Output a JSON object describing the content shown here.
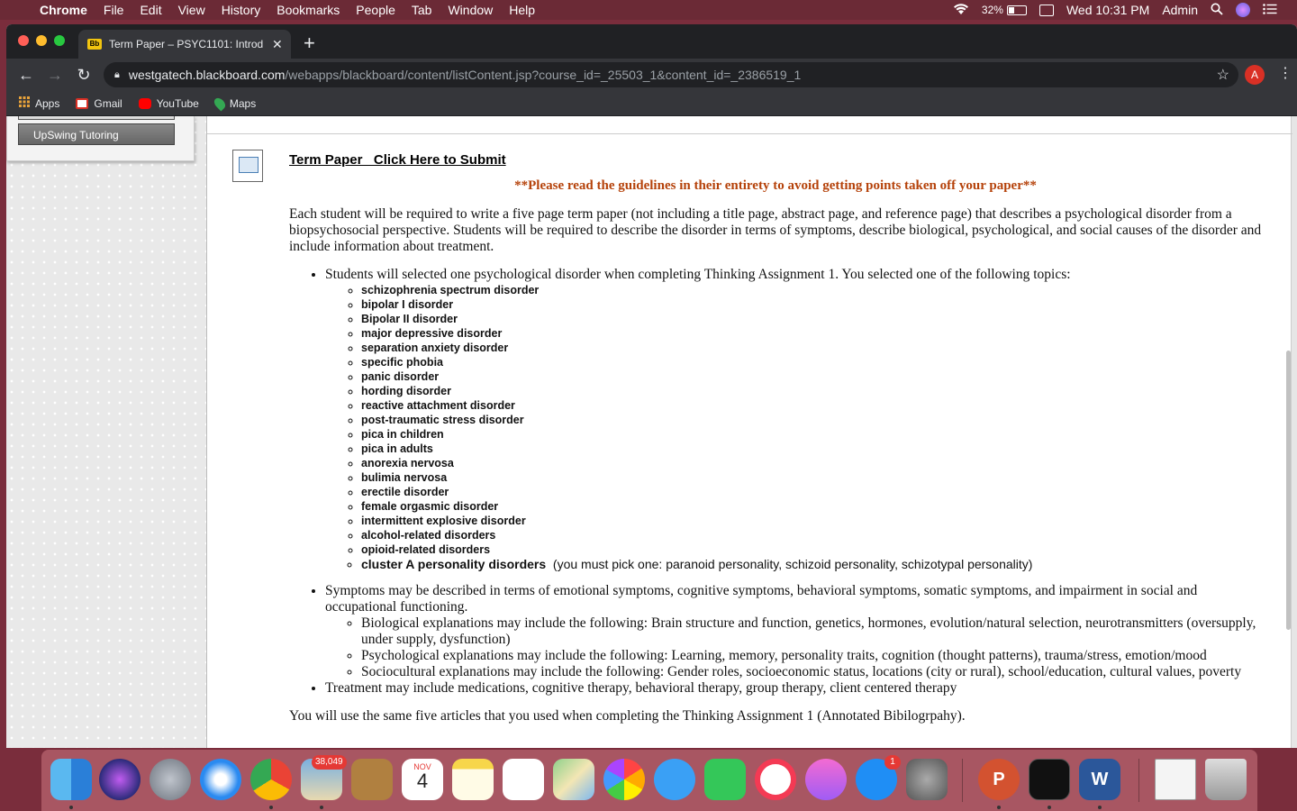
{
  "menubar": {
    "app": "Chrome",
    "items": [
      "File",
      "Edit",
      "View",
      "History",
      "Bookmarks",
      "People",
      "Tab",
      "Window",
      "Help"
    ],
    "battery": "32%",
    "clock": "Wed 10:31 PM",
    "user": "Admin"
  },
  "tab": {
    "favicon": "Bb",
    "title": "Term Paper – PSYC1101: Introd"
  },
  "address": {
    "host": "westgatech.blackboard.com",
    "path": "/webapps/blackboard/content/listContent.jsp?course_id=_25503_1&content_id=_2386519_1"
  },
  "profile_initial": "A",
  "bookmarks": [
    "Apps",
    "Gmail",
    "YouTube",
    "Maps"
  ],
  "sidebar": {
    "button": "UpSwing Tutoring"
  },
  "content": {
    "title": "Term Paper _Click Here to Submit",
    "warning": "**Please read the guidelines in their entirety to avoid getting points taken off your paper**",
    "intro": "Each student will be required to write a five page term paper (not including a title page, abstract page, and reference page) that describes a psychological disorder from a biopsychosocial perspective. Students will be required to describe the disorder in terms of symptoms, describe biological, psychological, and social causes of the disorder and include information about treatment.",
    "bullet1": "Students will selected one psychological disorder when completing Thinking Assignment 1.  You selected one of the following topics:",
    "topics": [
      "schizophrenia spectrum disorder",
      "bipolar I disorder",
      "Bipolar II disorder",
      "major depressive disorder",
      "separation anxiety disorder",
      "specific phobia",
      "panic disorder",
      "hording disorder",
      "reactive attachment disorder",
      "post-traumatic stress disorder",
      "pica in children",
      "pica in adults",
      "anorexia nervosa",
      "bulimia nervosa",
      "erectile disorder",
      "female orgasmic disorder",
      "intermittent explosive disorder",
      "alcohol-related disorders",
      "opioid-related disorders"
    ],
    "last_topic": "cluster A personality disorders",
    "last_topic_note": "  (you must pick one: paranoid personality, schizoid personality, schizotypal personality)",
    "bullet2": "Symptoms may be described in terms of emotional symptoms, cognitive symptoms, behavioral symptoms, somatic symptoms, and impairment in social and occupational functioning.",
    "sub_bullets": [
      "Biological explanations may include the following: Brain structure and function, genetics, hormones, evolution/natural selection, neurotransmitters (oversupply, under supply, dysfunction)",
      "Psychological explanations may include the following: Learning, memory, personality traits, cognition (thought patterns), trauma/stress, emotion/mood",
      "Sociocultural explanations may include the following: Gender roles, socioeconomic status, locations (city or rural), school/education, cultural values, poverty"
    ],
    "bullet3": "Treatment may include medications, cognitive therapy, behavioral therapy, group therapy, client centered therapy",
    "closing": "You will use the same five articles that you used when completing the Thinking Assignment 1 (Annotated Bibilogrpahy)."
  },
  "dock": {
    "mail_badge": "38,049",
    "calendar_month": "NOV",
    "calendar_day": "4",
    "appstore_badge": "1",
    "apps": [
      "finder",
      "siri",
      "launchpad",
      "safari",
      "chrome",
      "mail",
      "notefile",
      "calendar",
      "notes",
      "reminders",
      "maps",
      "photos",
      "messages",
      "facetime",
      "news",
      "music",
      "app-store",
      "system-preferences",
      "powerpoint",
      "terminal",
      "word",
      "document",
      "trash"
    ]
  }
}
